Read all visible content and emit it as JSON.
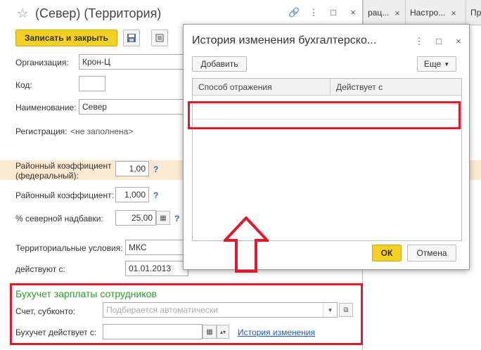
{
  "tabs": [
    {
      "label": "рац..."
    },
    {
      "label": "Настро..."
    },
    {
      "label": "Пр..."
    }
  ],
  "form": {
    "title": "(Север) (Территория)",
    "save_close_label": "Записать и закрыть",
    "org_label": "Организация:",
    "org_value": "Крон-Ц",
    "code_label": "Код:",
    "code_value": "",
    "name_label": "Наименование:",
    "name_value": "Север",
    "registration_label": "Регистрация:",
    "registration_value": "<не заполнена>",
    "rk_fed_label": "Районный коэффициент (федеральный):",
    "rk_fed_value": "1,00",
    "rk_label": "Районный коэффициент:",
    "rk_value": "1,000",
    "north_label": "% северной надбавки:",
    "north_value": "25,00",
    "terr_label": "Территориальные условия:",
    "terr_value": "МКС",
    "valid_label": "действуют с:",
    "valid_value": "01.01.2013",
    "help_mark": "?",
    "section_title": "Бухучет зарплаты сотрудников",
    "account_label": "Счет, субконто:",
    "account_placeholder": "Подбирается автоматически",
    "acc_valid_label": "Бухучет действует с:",
    "acc_valid_value": "",
    "history_link": "История изменения"
  },
  "dialog": {
    "title": "История изменения бухгалтерско...",
    "add_label": "Добавить",
    "more_label": "Еще",
    "columns": [
      "Способ отражения",
      "Действует с"
    ],
    "ok_label": "ОК",
    "cancel_label": "Отмена"
  },
  "colors": {
    "accent_yellow": "#f5d024",
    "highlight_red": "#e3192b",
    "section_green": "#2a9d2a",
    "link_blue": "#1c5fbf"
  }
}
